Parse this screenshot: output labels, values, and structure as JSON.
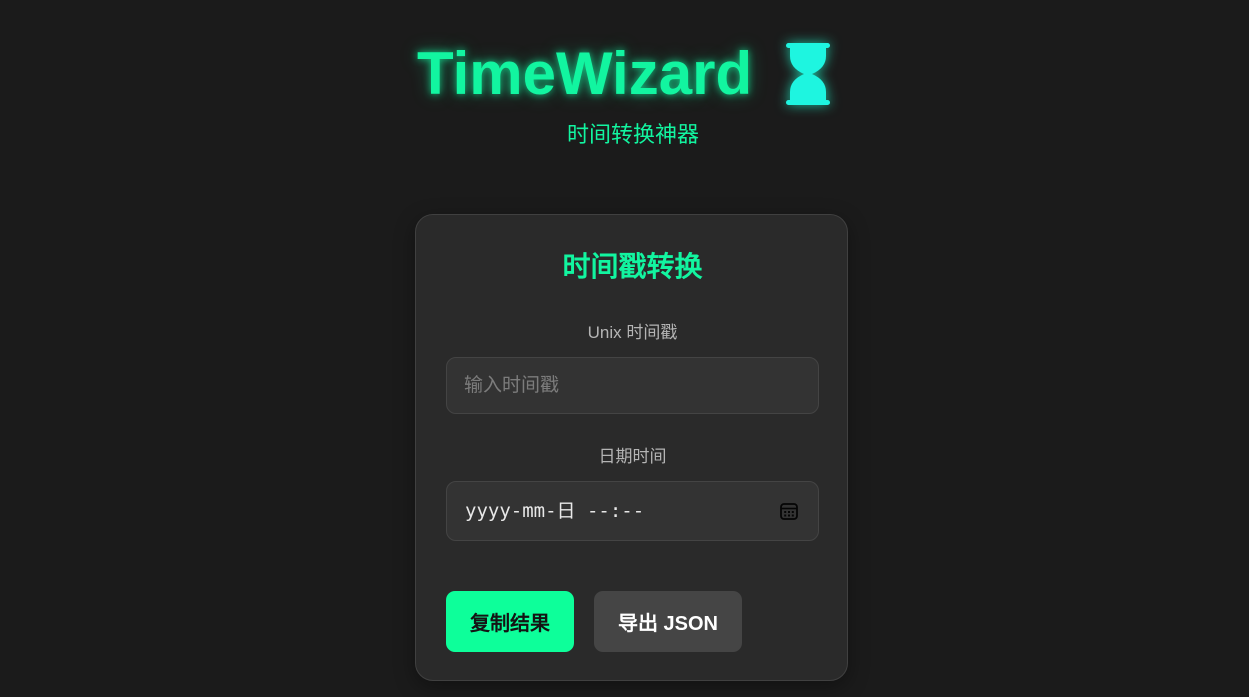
{
  "header": {
    "title": "TimeWizard",
    "subtitle": "时间转换神器"
  },
  "card": {
    "title": "时间戳转换",
    "unix_label": "Unix 时间戳",
    "unix_placeholder": "输入时间戳",
    "unix_value": "",
    "datetime_label": "日期时间",
    "datetime_placeholder": "yyyy-mm-日 --:--"
  },
  "buttons": {
    "copy_label": "复制结果",
    "export_label": "导出 JSON"
  },
  "icons": {
    "logo": "hourglass-icon",
    "date_picker": "calendar-icon"
  },
  "colors": {
    "background": "#1b1b1b",
    "card": "#2a2a2a",
    "accent": "#12f5a0",
    "hourglass": "#1ef5e0",
    "primary_button": "#0dff9a",
    "secondary_button": "#454545"
  }
}
